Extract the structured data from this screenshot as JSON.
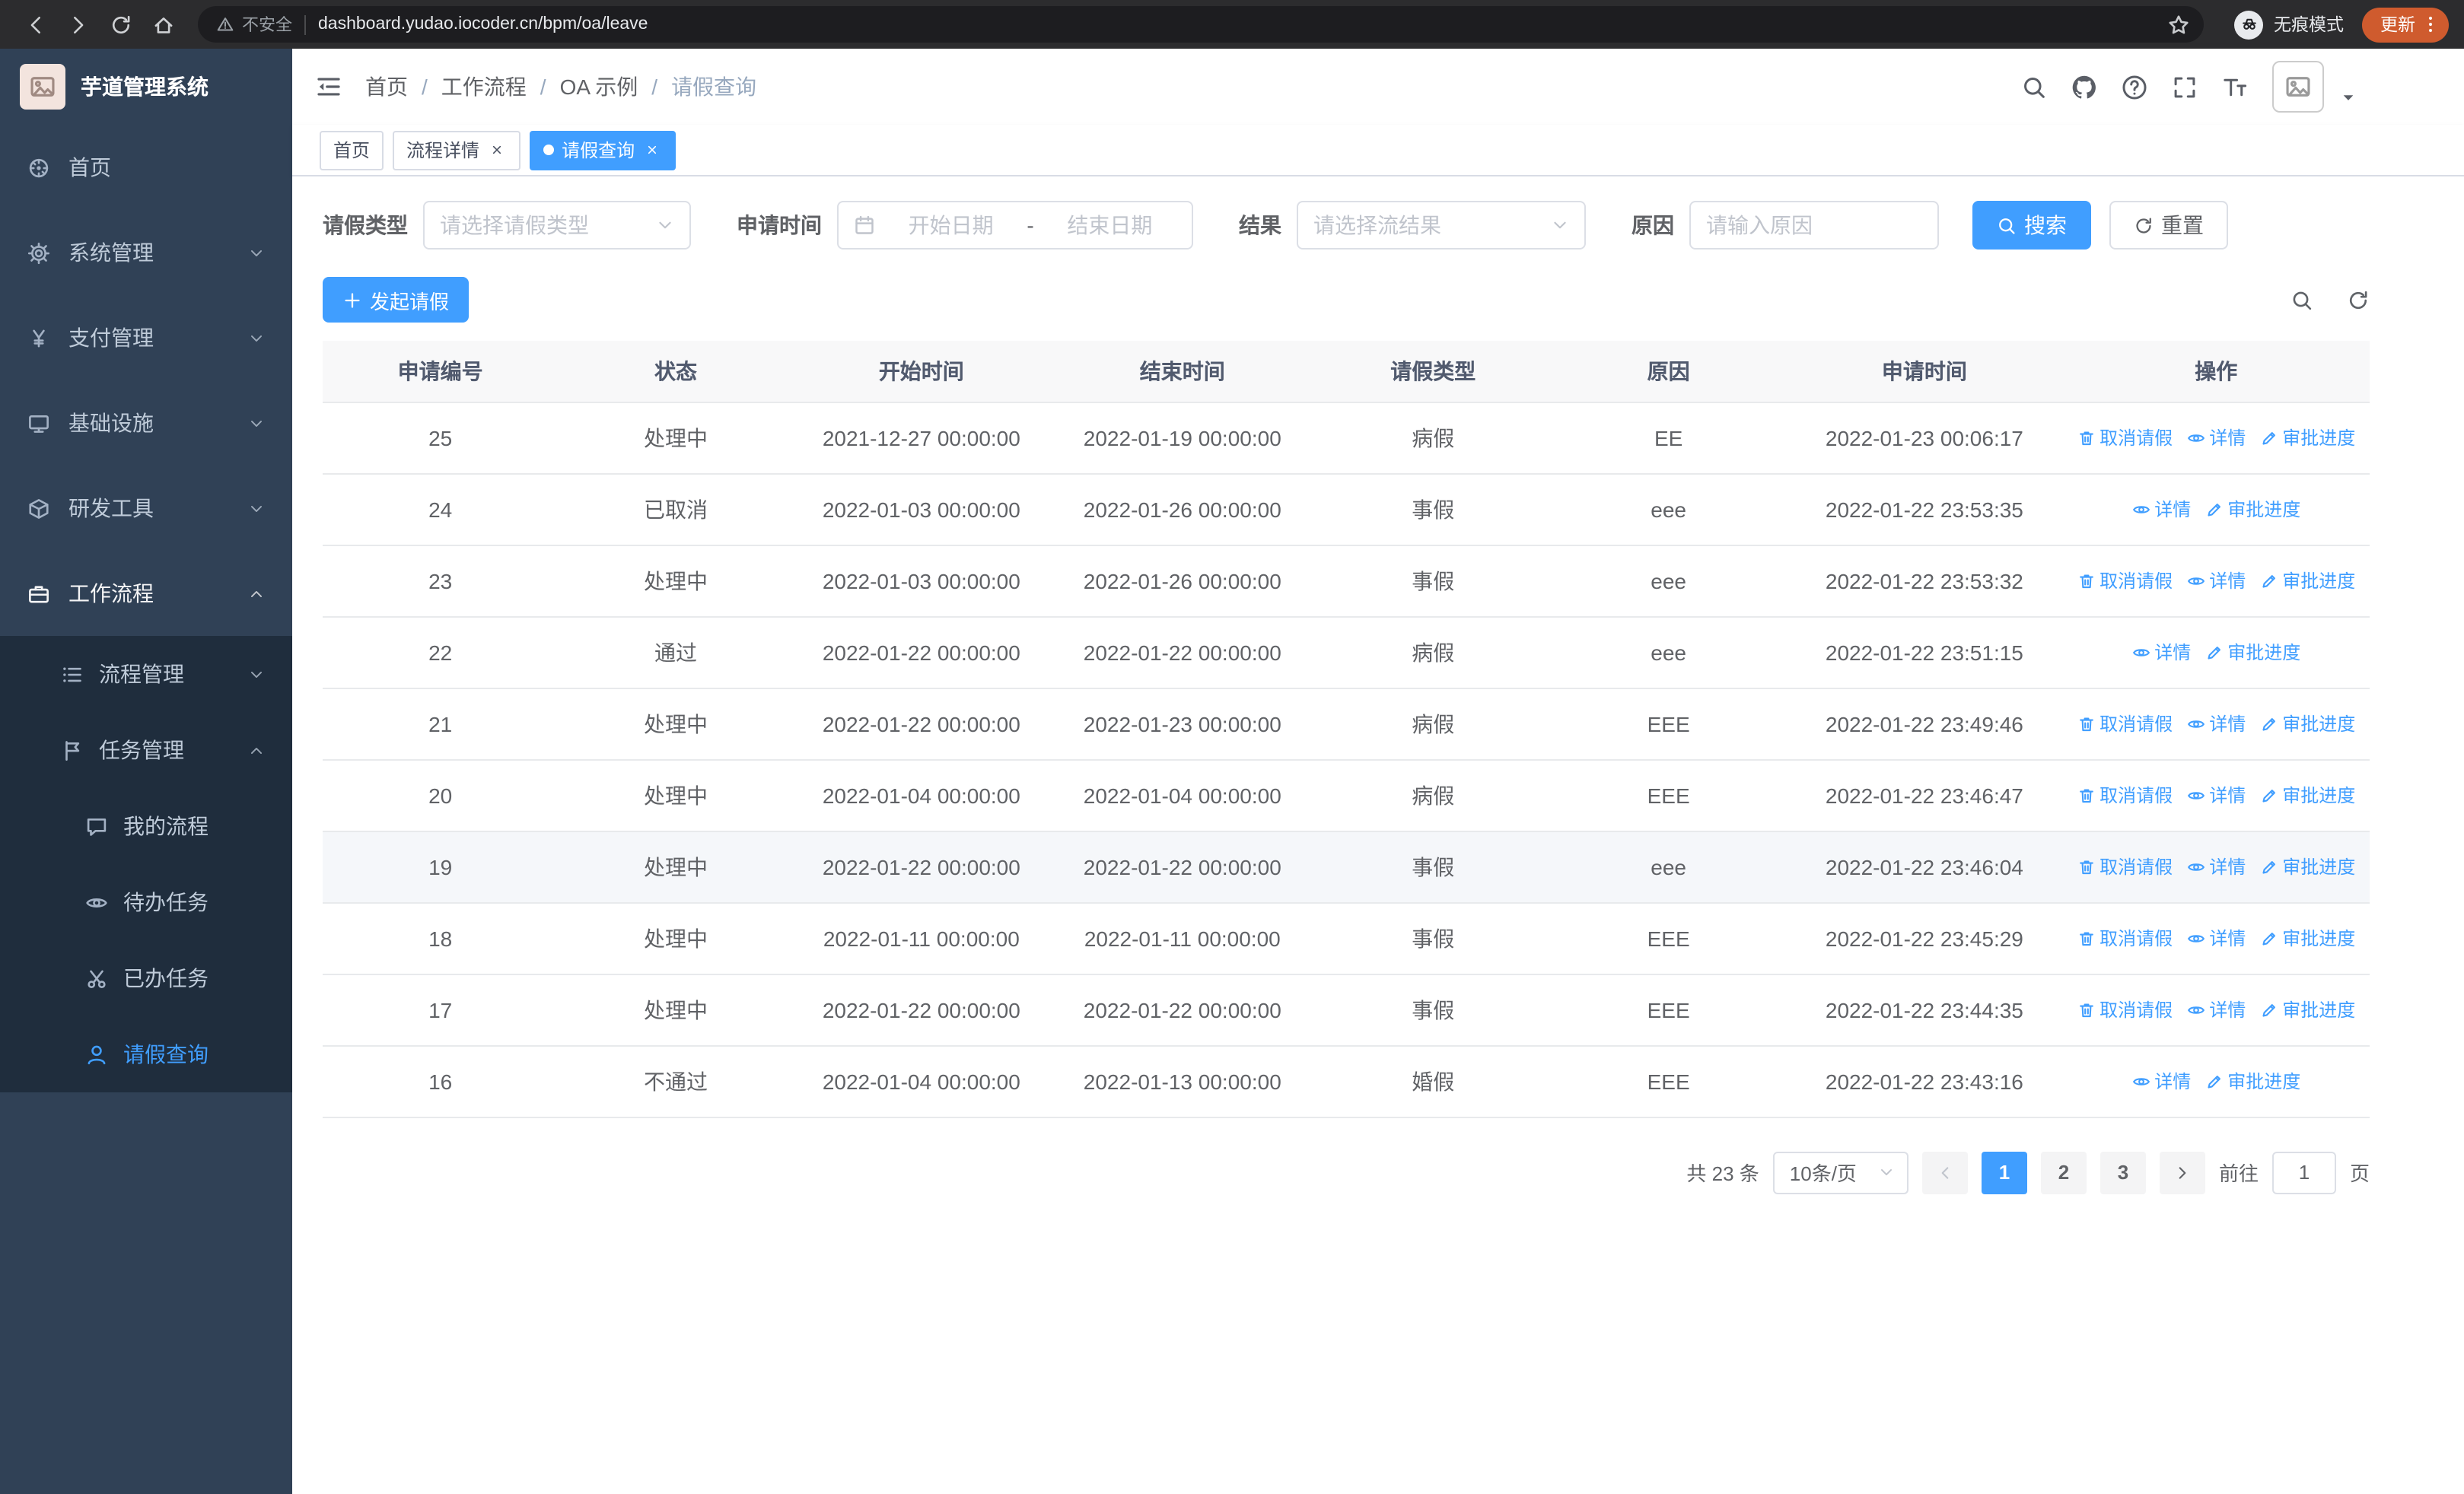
{
  "browser": {
    "security_label": "不安全",
    "url": "dashboard.yudao.iocoder.cn/bpm/oa/leave",
    "incognito_label": "无痕模式",
    "update_label": "更新"
  },
  "sidebar": {
    "app_title": "芋道管理系统",
    "items": [
      {
        "name": "home",
        "label": "首页",
        "icon": "dashboard-icon",
        "type": "leaf"
      },
      {
        "name": "system-management",
        "label": "系统管理",
        "icon": "gear-icon",
        "type": "group",
        "state": "collapsed"
      },
      {
        "name": "payment-management",
        "label": "支付管理",
        "icon": "yen-icon",
        "type": "group",
        "state": "collapsed"
      },
      {
        "name": "infrastructure",
        "label": "基础设施",
        "icon": "monitor-icon",
        "type": "group",
        "state": "collapsed"
      },
      {
        "name": "devtools",
        "label": "研发工具",
        "icon": "cube-icon",
        "type": "group",
        "state": "collapsed"
      },
      {
        "name": "workflow",
        "label": "工作流程",
        "icon": "briefcase-icon",
        "type": "group",
        "state": "expanded",
        "active": true
      }
    ],
    "workflow_submenu": [
      {
        "name": "process-management",
        "label": "流程管理",
        "icon": "list-icon",
        "type": "group",
        "state": "collapsed"
      },
      {
        "name": "task-management",
        "label": "任务管理",
        "icon": "flag-icon",
        "type": "group",
        "state": "expanded"
      }
    ],
    "task_submenu": [
      {
        "name": "my-process",
        "label": "我的流程",
        "icon": "chat-icon"
      },
      {
        "name": "todo-task",
        "label": "待办任务",
        "icon": "eye-icon"
      },
      {
        "name": "done-task",
        "label": "已办任务",
        "icon": "scissors-icon"
      },
      {
        "name": "leave-query",
        "label": "请假查询",
        "icon": "user-icon",
        "active": true
      }
    ]
  },
  "navbar": {
    "breadcrumb": [
      "首页",
      "工作流程",
      "OA 示例",
      "请假查询"
    ],
    "icons": [
      "search-icon",
      "github-icon",
      "question-icon",
      "fullscreen-icon",
      "font-size-icon"
    ]
  },
  "tabs": [
    {
      "name": "home",
      "label": "首页",
      "closable": false,
      "active": false
    },
    {
      "name": "process-detail",
      "label": "流程详情",
      "closable": true,
      "active": false
    },
    {
      "name": "leave-query",
      "label": "请假查询",
      "closable": true,
      "active": true
    }
  ],
  "filters": {
    "leave_type": {
      "label": "请假类型",
      "placeholder": "请选择请假类型"
    },
    "apply_time": {
      "label": "申请时间",
      "start_placeholder": "开始日期",
      "separator": "-",
      "end_placeholder": "结束日期"
    },
    "result": {
      "label": "结果",
      "placeholder": "请选择流结果"
    },
    "reason": {
      "label": "原因",
      "placeholder": "请输入原因"
    },
    "search_button": "搜索",
    "reset_button": "重置"
  },
  "toolbar": {
    "create_button": "发起请假",
    "icons": [
      "search-icon",
      "refresh-icon"
    ]
  },
  "table": {
    "columns": [
      "申请编号",
      "状态",
      "开始时间",
      "结束时间",
      "请假类型",
      "原因",
      "申请时间",
      "操作"
    ],
    "action_sets": {
      "full": [
        {
          "label": "取消请假",
          "icon": "delete-icon",
          "name": "cancel-leave-link"
        },
        {
          "label": "详情",
          "icon": "eye-icon",
          "name": "detail-link"
        },
        {
          "label": "审批进度",
          "icon": "edit-icon",
          "name": "approval-progress-link"
        }
      ],
      "readonly": [
        {
          "label": "详情",
          "icon": "eye-icon",
          "name": "detail-link"
        },
        {
          "label": "审批进度",
          "icon": "edit-icon",
          "name": "approval-progress-link"
        }
      ]
    },
    "rows": [
      {
        "id": "25",
        "status": "处理中",
        "start_time": "2021-12-27 00:00:00",
        "end_time": "2022-01-19 00:00:00",
        "leave_type": "病假",
        "reason": "EE",
        "apply_time": "2022-01-23 00:06:17",
        "actions": "full"
      },
      {
        "id": "24",
        "status": "已取消",
        "start_time": "2022-01-03 00:00:00",
        "end_time": "2022-01-26 00:00:00",
        "leave_type": "事假",
        "reason": "eee",
        "apply_time": "2022-01-22 23:53:35",
        "actions": "readonly"
      },
      {
        "id": "23",
        "status": "处理中",
        "start_time": "2022-01-03 00:00:00",
        "end_time": "2022-01-26 00:00:00",
        "leave_type": "事假",
        "reason": "eee",
        "apply_time": "2022-01-22 23:53:32",
        "actions": "full"
      },
      {
        "id": "22",
        "status": "通过",
        "start_time": "2022-01-22 00:00:00",
        "end_time": "2022-01-22 00:00:00",
        "leave_type": "病假",
        "reason": "eee",
        "apply_time": "2022-01-22 23:51:15",
        "actions": "readonly"
      },
      {
        "id": "21",
        "status": "处理中",
        "start_time": "2022-01-22 00:00:00",
        "end_time": "2022-01-23 00:00:00",
        "leave_type": "病假",
        "reason": "EEE",
        "apply_time": "2022-01-22 23:49:46",
        "actions": "full"
      },
      {
        "id": "20",
        "status": "处理中",
        "start_time": "2022-01-04 00:00:00",
        "end_time": "2022-01-04 00:00:00",
        "leave_type": "病假",
        "reason": "EEE",
        "apply_time": "2022-01-22 23:46:47",
        "actions": "full"
      },
      {
        "id": "19",
        "status": "处理中",
        "start_time": "2022-01-22 00:00:00",
        "end_time": "2022-01-22 00:00:00",
        "leave_type": "事假",
        "reason": "eee",
        "apply_time": "2022-01-22 23:46:04",
        "actions": "full",
        "hover": true
      },
      {
        "id": "18",
        "status": "处理中",
        "start_time": "2022-01-11 00:00:00",
        "end_time": "2022-01-11 00:00:00",
        "leave_type": "事假",
        "reason": "EEE",
        "apply_time": "2022-01-22 23:45:29",
        "actions": "full"
      },
      {
        "id": "17",
        "status": "处理中",
        "start_time": "2022-01-22 00:00:00",
        "end_time": "2022-01-22 00:00:00",
        "leave_type": "事假",
        "reason": "EEE",
        "apply_time": "2022-01-22 23:44:35",
        "actions": "full"
      },
      {
        "id": "16",
        "status": "不通过",
        "start_time": "2022-01-04 00:00:00",
        "end_time": "2022-01-13 00:00:00",
        "leave_type": "婚假",
        "reason": "EEE",
        "apply_time": "2022-01-22 23:43:16",
        "actions": "readonly"
      }
    ]
  },
  "pagination": {
    "total_text": "共 23 条",
    "page_size_label": "10条/页",
    "pages": [
      "1",
      "2",
      "3"
    ],
    "active_page": "1",
    "prev_enabled": false,
    "next_enabled": true,
    "goto_label": "前往",
    "goto_value": "1",
    "goto_unit": "页"
  }
}
